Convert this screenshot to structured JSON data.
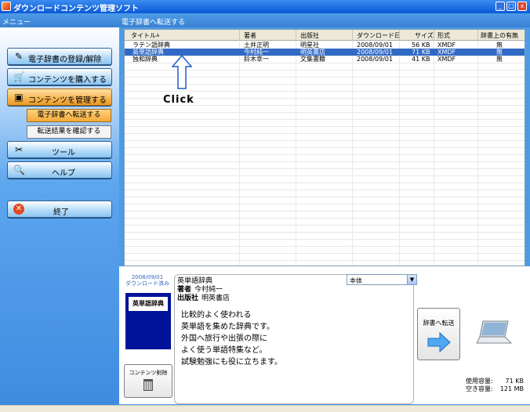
{
  "window": {
    "title": "ダウンロードコンテンツ管理ソフト"
  },
  "sidebar": {
    "header": "メニュー",
    "buttons": [
      {
        "label": "電子辞書の登録/解除",
        "icon": "key-icon"
      },
      {
        "label": "コンテンツを購入する",
        "icon": "cart-icon"
      },
      {
        "label": "コンテンツを管理する",
        "icon": "manage-icon"
      }
    ],
    "sub_items": [
      {
        "label": "電子辞書へ転送する"
      },
      {
        "label": "転送結果を確認する"
      }
    ],
    "more_buttons": [
      {
        "label": "ツール",
        "icon": "tools-icon"
      },
      {
        "label": "ヘルプ",
        "icon": "help-icon"
      }
    ],
    "exit_label": "終了"
  },
  "panel": {
    "header": "電子辞書へ転送する",
    "columns": [
      "タイトル",
      "著者",
      "出版社",
      "ダウンロード日",
      "サイズ",
      "形式",
      "辞書上の有無"
    ],
    "sort_indicator": "▲",
    "rows": [
      {
        "title": "ラテン語辞典",
        "author": "土井正明",
        "publisher": "明星社",
        "date": "2008/09/01",
        "size": "56 KB",
        "format": "XMDF",
        "on_device": "無"
      },
      {
        "title": "英単語辞典",
        "author": "今村純一",
        "publisher": "明英書店",
        "date": "2008/09/01",
        "size": "71 KB",
        "format": "XMDF",
        "on_device": "無"
      },
      {
        "title": "独和辞典",
        "author": "鈴木幸一",
        "publisher": "文集書籍",
        "date": "2008/09/01",
        "size": "41 KB",
        "format": "XMDF",
        "on_device": "無"
      }
    ],
    "click_annotation": "Click"
  },
  "detail": {
    "download_date": "2008/09/01",
    "download_status": "ダウンロード済み",
    "cover_title": "英単語辞典",
    "delete_label": "コンテンツ削除",
    "title": "英単語辞典",
    "author_label": "著者",
    "author": "今村純一",
    "publisher_label": "出版社",
    "publisher": "明英書店",
    "description": [
      "比較的よく使われる",
      "英単語を集めた辞典です。",
      "外国へ旅行や出張の際に",
      "よく使う単語特集など。",
      "試験勉強にも役に立ちます。"
    ],
    "device_select": "本体",
    "send_label": "辞書へ転送",
    "usage_label": "使用容量:",
    "usage_value": "71 KB",
    "free_label": "空き容量:",
    "free_value": "121 MB"
  }
}
